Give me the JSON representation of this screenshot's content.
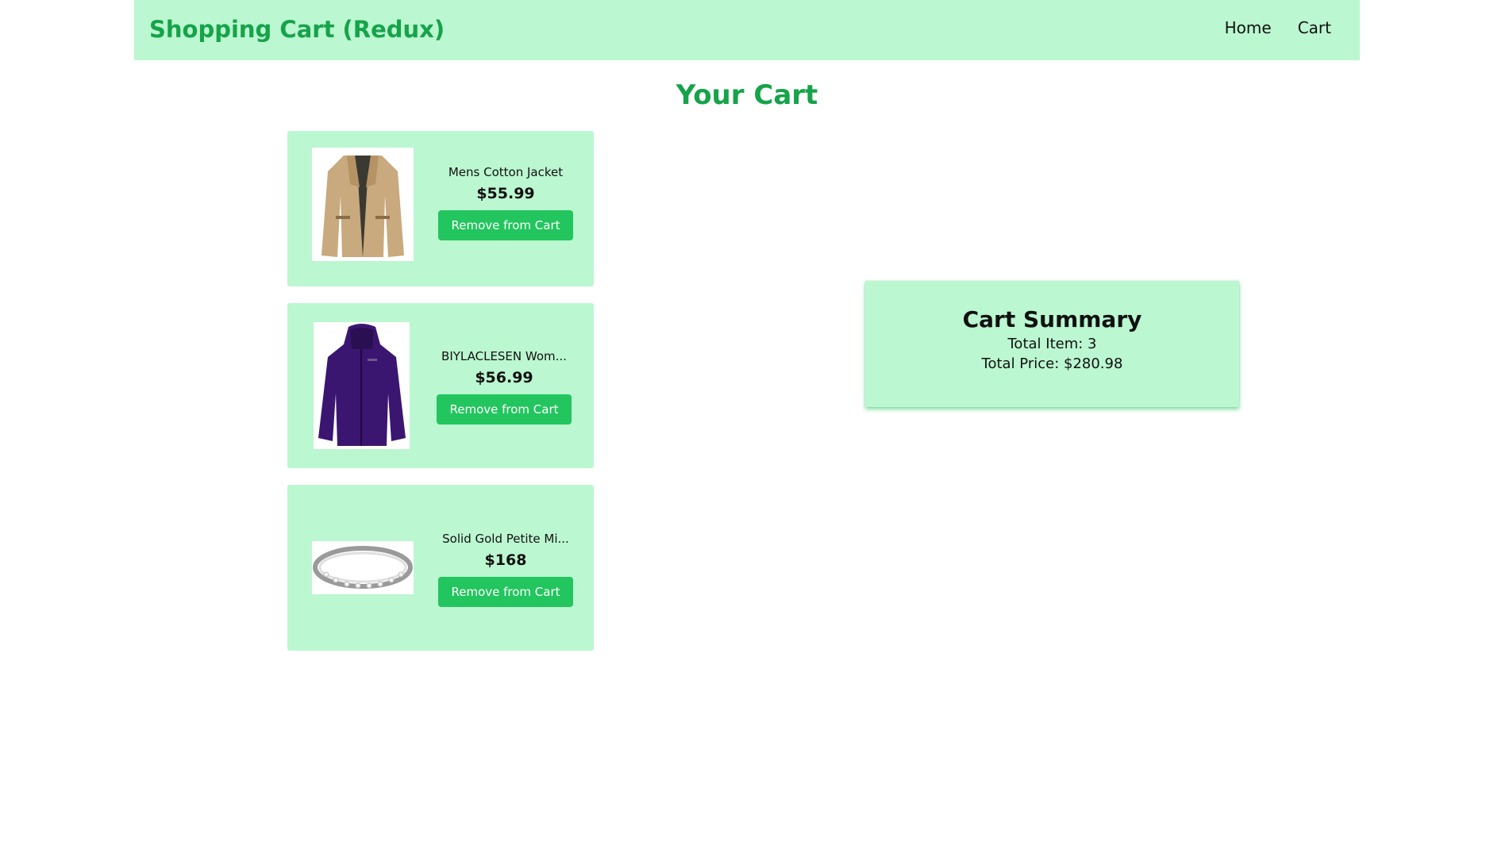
{
  "header": {
    "brand": "Shopping Cart (Redux)",
    "nav": [
      {
        "label": "Home"
      },
      {
        "label": "Cart"
      }
    ]
  },
  "page_title": "Your Cart",
  "items": [
    {
      "name": "Mens Cotton Jacket",
      "price": "$55.99",
      "button": "Remove from Cart",
      "image_icon": "jacket-image"
    },
    {
      "name": "BIYLACLESEN Wom...",
      "price": "$56.99",
      "button": "Remove from Cart",
      "image_icon": "purple-jacket-image"
    },
    {
      "name": "Solid Gold Petite Mi...",
      "price": "$168",
      "button": "Remove from Cart",
      "image_icon": "ring-image"
    }
  ],
  "summary": {
    "title": "Cart Summary",
    "total_items_label": "Total Item: 3",
    "total_price_label": "Total Price: $280.98"
  },
  "colors": {
    "accent": "#16a34a",
    "button": "#22c55e",
    "panel": "#bbf7d0"
  }
}
